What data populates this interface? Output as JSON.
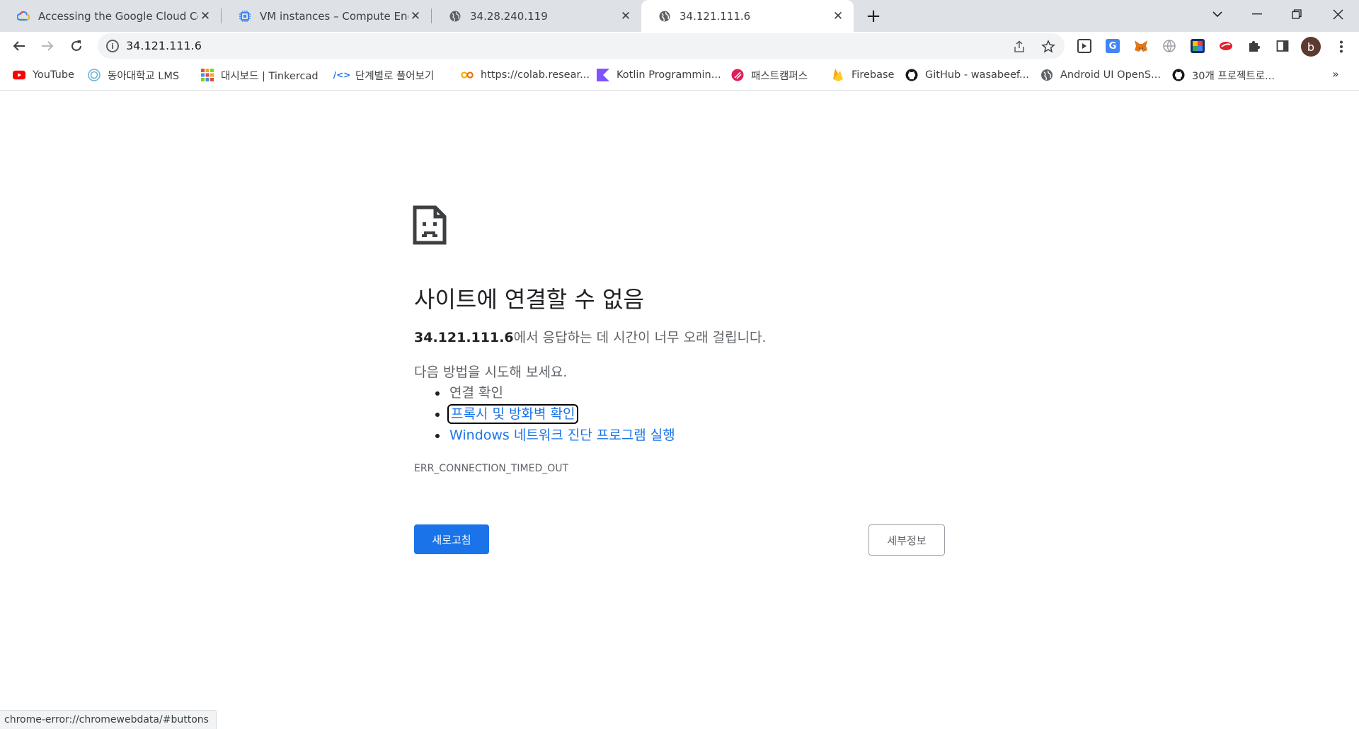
{
  "tabs": [
    {
      "title": "Accessing the Google Cloud Co",
      "icon": "google-cloud-icon",
      "active": false
    },
    {
      "title": "VM instances – Compute Engine",
      "icon": "compute-engine-icon",
      "active": false
    },
    {
      "title": "34.28.240.119",
      "icon": "globe-icon",
      "active": false
    },
    {
      "title": "34.121.111.6",
      "icon": "globe-icon",
      "active": true
    }
  ],
  "tab_close_glyph": "✕",
  "new_tab_glyph": "+",
  "address_bar": {
    "url": "34.121.111.6"
  },
  "bookmarks": [
    {
      "label": "YouTube",
      "icon": "youtube-icon"
    },
    {
      "label": "동아대학교 LMS",
      "icon": "lms-icon"
    },
    {
      "label": "대시보드 | Tinkercad",
      "icon": "tinkercad-icon"
    },
    {
      "label": "단계별로 풀어보기",
      "icon": "code-icon"
    },
    {
      "label": "https://colab.resear...",
      "icon": "colab-icon"
    },
    {
      "label": "Kotlin Programmin...",
      "icon": "kotlin-icon"
    },
    {
      "label": "패스트캠퍼스",
      "icon": "fastcampus-icon"
    },
    {
      "label": "Firebase",
      "icon": "firebase-icon"
    },
    {
      "label": "GitHub - wasabeef...",
      "icon": "github-icon"
    },
    {
      "label": "Android UI OpenS...",
      "icon": "globe-icon"
    },
    {
      "label": "30개 프로젝트로...",
      "icon": "github-icon"
    }
  ],
  "bookmarks_more": "»",
  "profile": {
    "initial": "b"
  },
  "error_page": {
    "heading": "사이트에 연결할 수 없음",
    "host": "34.121.111.6",
    "description": "에서 응답하는 데 시간이 너무 오래 걸립니다.",
    "suggestions_title": "다음 방법을 시도해 보세요.",
    "suggestions": [
      {
        "text": "연결 확인",
        "link": false
      },
      {
        "text": "프록시 및 방화벽 확인",
        "link": true
      },
      {
        "text": "Windows 네트워크 진단 프로그램 실행",
        "link": true
      }
    ],
    "error_code": "ERR_CONNECTION_TIMED_OUT",
    "reload_label": "새로고침",
    "details_label": "세부정보"
  },
  "status_bar": {
    "text": "chrome-error://chromewebdata/#buttons"
  },
  "colors": {
    "primary_blue": "#1a73e8",
    "tab_strip": "#dee1e6"
  }
}
